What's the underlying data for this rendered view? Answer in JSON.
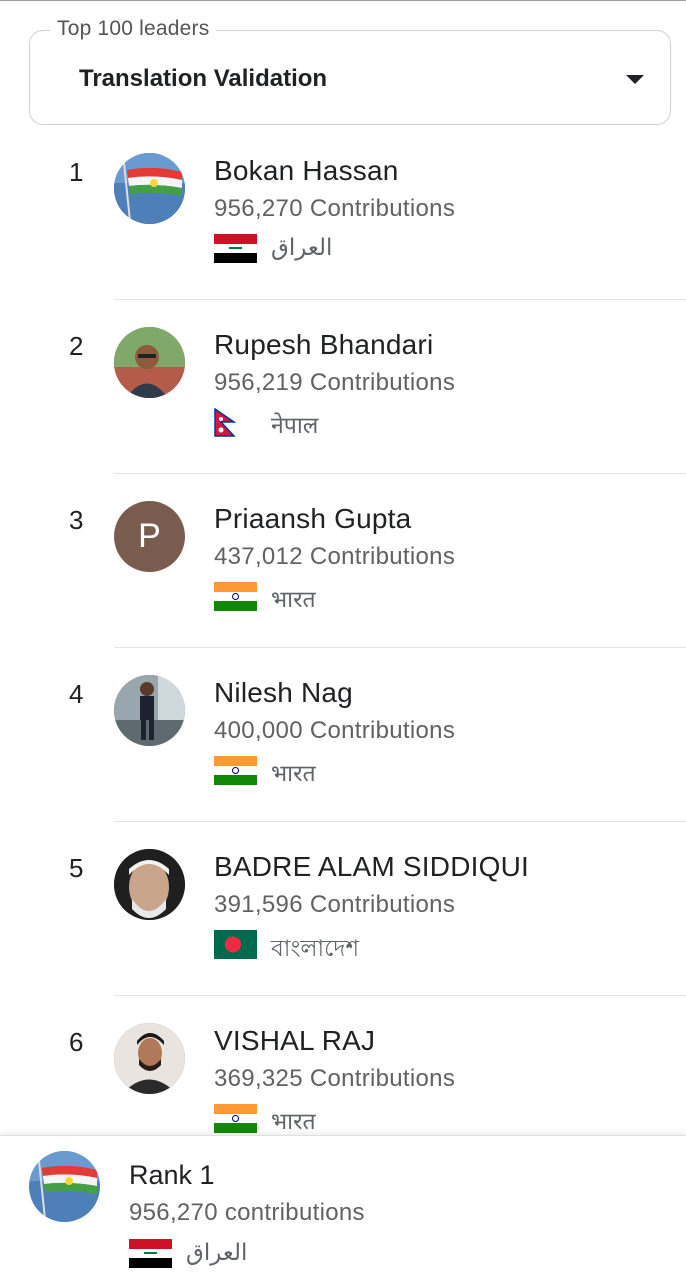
{
  "filter": {
    "legend": "Top 100 leaders",
    "selected": "Translation Validation"
  },
  "leaders": [
    {
      "rank": "1",
      "name": "Bokan Hassan",
      "contributions": "956,270 Contributions",
      "country": "العراق",
      "flag": "iraq-flag"
    },
    {
      "rank": "2",
      "name": "Rupesh Bhandari",
      "contributions": "956,219 Contributions",
      "country": "नेपाल",
      "flag": "nepal-flag"
    },
    {
      "rank": "3",
      "name": "Priaansh Gupta",
      "contributions": "437,012 Contributions",
      "country": "भारत",
      "flag": "india-flag",
      "avatar_letter": "P"
    },
    {
      "rank": "4",
      "name": "Nilesh Nag",
      "contributions": "400,000 Contributions",
      "country": "भारत",
      "flag": "india-flag"
    },
    {
      "rank": "5",
      "name": "BADRE ALAM SIDDIQUI",
      "contributions": "391,596 Contributions",
      "country": "বাংলাদেশ",
      "flag": "bangladesh-flag"
    },
    {
      "rank": "6",
      "name": "VISHAL RAJ",
      "contributions": "369,325 Contributions",
      "country": "भारत",
      "flag": "india-flag"
    }
  ],
  "me": {
    "rank": "Rank 1",
    "contributions": "956,270 contributions",
    "country": "العراق",
    "flag": "iraq-flag"
  },
  "colors": {
    "letter_avatar_bg": "#7a5c4f",
    "divider": "#e4e4e4"
  }
}
